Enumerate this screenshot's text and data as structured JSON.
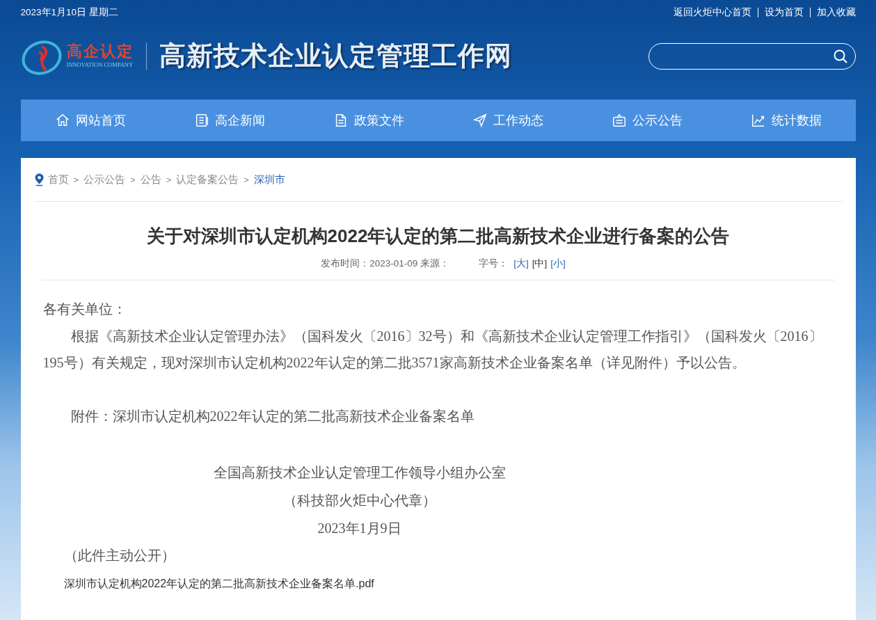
{
  "top_bar": {
    "date": "2023年1月10日 星期二",
    "links": [
      "返回火炬中心首页",
      "设为首页",
      "加入收藏"
    ]
  },
  "header": {
    "logo_text": "高企认定",
    "logo_subtext": "INNOVATION COMPANY",
    "site_title": "高新技术企业认定管理工作网"
  },
  "nav": [
    {
      "label": "网站首页",
      "kind": "home"
    },
    {
      "label": "高企新闻",
      "kind": "news"
    },
    {
      "label": "政策文件",
      "kind": "document"
    },
    {
      "label": "工作动态",
      "kind": "send"
    },
    {
      "label": "公示公告",
      "kind": "notice"
    },
    {
      "label": "统计数据",
      "kind": "chart"
    }
  ],
  "breadcrumb": [
    {
      "label": "首页",
      "current": false
    },
    {
      "separator": ">",
      "label": "公示公告",
      "current": false
    },
    {
      "separator": ">",
      "label": "公告",
      "current": false
    },
    {
      "separator": ">",
      "label": "认定备案公告",
      "current": false
    },
    {
      "separator": ">",
      "label": "深圳市",
      "current": true
    }
  ],
  "article": {
    "title": "关于对深圳市认定机构2022年认定的第二批高新技术企业进行备案的公告",
    "meta": "发布时间：2023-01-09 来源：",
    "font_size_label": "字号：",
    "font_sizes": [
      {
        "label": "[大]",
        "selected": false
      },
      {
        "label": "[中]",
        "selected": true
      },
      {
        "label": "[小]",
        "selected": false
      }
    ],
    "salutation": "各有关单位：",
    "paragraphs": [
      "根据《高新技术企业认定管理办法》（国科发火〔2016〕32号）和《高新技术企业认定管理工作指引》（国科发火〔2016〕195号）有关规定，现对深圳市认定机构2022年认定的第二批3571家高新技术企业备案名单（详见附件）予以公告。",
      "附件：深圳市认定机构2022年认定的第二批高新技术企业备案名单"
    ],
    "signature": [
      "全国高新技术企业认定管理工作领导小组办公室",
      "（科技部火炬中心代章）",
      "2023年1月9日"
    ],
    "note": "（此件主动公开）",
    "attachment_link": "深圳市认定机构2022年认定的第二批高新技术企业备案名单.pdf"
  }
}
